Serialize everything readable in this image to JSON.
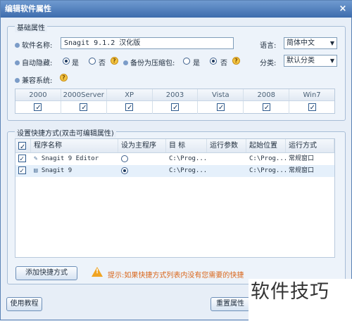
{
  "window": {
    "title": "编辑软件属性",
    "close_glyph": "×"
  },
  "basic": {
    "legend": "基础属性",
    "name_label": "软件名称:",
    "name_value": "Snagit 9.1.2 汉化版",
    "lang_label": "语言:",
    "lang_value": "简体中文",
    "autohide_label": "自动隐藏:",
    "yes": "是",
    "no": "否",
    "backup_label": "备份为压缩包:",
    "category_label": "分类:",
    "category_value": "默认分类",
    "compat_label": "兼容系统:",
    "help_glyph": "?",
    "autohide_selected": "yes",
    "backup_selected": "no"
  },
  "compat": {
    "systems": [
      {
        "name": "2000",
        "checked": true
      },
      {
        "name": "2000Server",
        "checked": true
      },
      {
        "name": "XP",
        "checked": true
      },
      {
        "name": "2003",
        "checked": true
      },
      {
        "name": "Vista",
        "checked": true
      },
      {
        "name": "2008",
        "checked": true
      },
      {
        "name": "Win7",
        "checked": true
      }
    ]
  },
  "shortcuts": {
    "legend": "设置快捷方式(双击可编辑属性)",
    "columns": [
      "程序名称",
      "设为主程序",
      "目 标",
      "运行参数",
      "起始位置",
      "运行方式"
    ],
    "rows": [
      {
        "name": "Snagit 9 Editor",
        "main": false,
        "target": "C:\\Prog...",
        "args": "",
        "start": "C:\\Prog...",
        "mode": "常规窗口"
      },
      {
        "name": "Snagit 9",
        "main": true,
        "target": "C:\\Prog...",
        "args": "",
        "start": "C:\\Prog...",
        "mode": "常规窗口"
      }
    ]
  },
  "actions": {
    "add_shortcut": "添加快捷方式",
    "hint": "提示:如果快捷方式列表内没有您需要的快捷",
    "tutorial": "使用教程",
    "reset": "重置属性"
  },
  "overlay": {
    "watermark": "软件技巧"
  },
  "colors": {
    "title_bar": "#3d6cad",
    "hint": "#d9661b",
    "warning": "#f0a422"
  }
}
